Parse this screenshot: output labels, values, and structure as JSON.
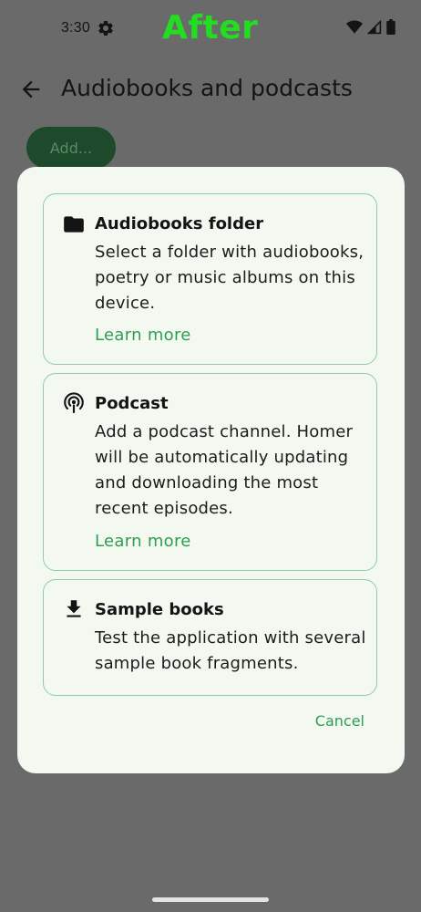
{
  "status_bar": {
    "time": "3:30",
    "overlay_label": "After"
  },
  "app_bar": {
    "title": "Audiobooks and podcasts"
  },
  "add_button": {
    "label": "Add..."
  },
  "dialog": {
    "cards": [
      {
        "icon": "folder-icon",
        "title": "Audiobooks folder",
        "description": "Select a folder with audiobooks, poetry or music albums on this device.",
        "link": "Learn more"
      },
      {
        "icon": "podcast-icon",
        "title": "Podcast",
        "description": "Add a podcast channel. Homer will be automatically updating and downloading the most recent episodes.",
        "link": "Learn more"
      },
      {
        "icon": "download-icon",
        "title": "Sample books",
        "description": "Test the application with several sample book fragments."
      }
    ],
    "cancel_label": "Cancel"
  },
  "colors": {
    "accent": "#2e9e52",
    "card_border": "#8fcca0",
    "dialog_bg": "#f3f9f1",
    "scrim": "#6a6a6a",
    "after_label": "#22dd22"
  }
}
